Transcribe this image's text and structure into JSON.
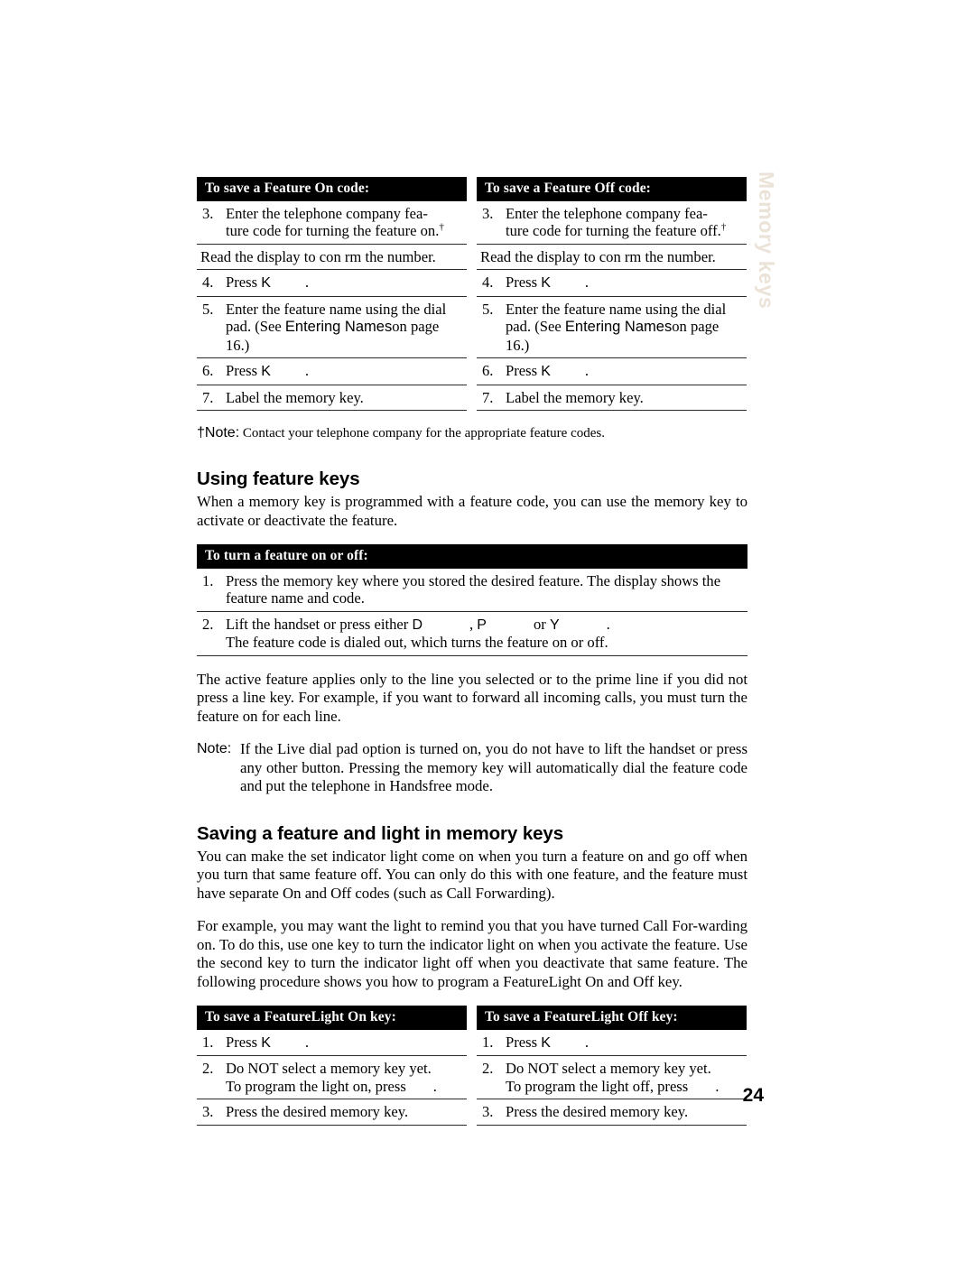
{
  "page": {
    "number": "24",
    "side_tab": "Memory keys"
  },
  "feature_code_tables": {
    "on": {
      "header": "To save a Feature On code:",
      "rows": [
        {
          "num": "3.",
          "text": "Enter the telephone company fea-ture code for turning the feature on.",
          "sup": "†"
        },
        {
          "num": "",
          "text": "Read the display to con  rm the number."
        },
        {
          "num": "4.",
          "text": "Press K",
          "trailing": "."
        },
        {
          "num": "5.",
          "text": "pad. (See ",
          "pre": "Enter the feature name using the dial ",
          "xref": "Entering Names",
          "post": "on page 16.)"
        },
        {
          "num": "6.",
          "text": "Press K",
          "trailing": "."
        },
        {
          "num": "7.",
          "text": "Label the memory key."
        }
      ]
    },
    "off": {
      "header": "To save a Feature Off code:",
      "rows": [
        {
          "num": "3.",
          "text": "Enter the telephone company fea-ture code for turning the feature off.",
          "sup": "†"
        },
        {
          "num": "",
          "text": "Read the display to con  rm the number."
        },
        {
          "num": "4.",
          "text": "Press K",
          "trailing": "."
        },
        {
          "num": "5.",
          "text": "pad. (See ",
          "pre": "Enter the feature name using the dial ",
          "xref": "Entering Names",
          "post": "on page 16.)"
        },
        {
          "num": "6.",
          "text": "Press K",
          "trailing": "."
        },
        {
          "num": "7.",
          "text": "Label the memory key."
        }
      ]
    },
    "footnote_label": "†Note:",
    "footnote_text": "Contact your telephone company for the appropriate feature codes."
  },
  "using_feature_keys": {
    "heading": "Using feature keys",
    "intro": "When a memory key is programmed with a feature code, you can use the memory key to activate or deactivate the feature.",
    "table": {
      "header": "To turn a feature on or off:",
      "rows": [
        {
          "num": "1.",
          "text": "Press the memory key where you stored the desired feature. The display shows the feature name and code."
        },
        {
          "num": "2.",
          "line1_a": "Lift the handset or press either ",
          "key1": "D",
          "sep1": ", ",
          "key2": "P",
          "sep2": "or ",
          "key3": "Y",
          "end": ".",
          "line2": "The feature code is dialed out, which turns the feature on or off."
        }
      ]
    },
    "para_after": "The active feature applies only to the line you selected or to the prime line if you did not press a line key. For example, if you want to forward all incoming calls, you must turn the feature on for each line.",
    "note_label": "Note:",
    "note_text": "If the Live dial pad option is turned on, you do not have to lift the handset or press any other button. Pressing the memory key will automatically dial the feature code and put the telephone in Handsfree mode."
  },
  "saving_feature_light": {
    "heading": "Saving a feature and light in memory keys",
    "para1": "You can make the set indicator light come on when you turn a feature on and go off when you turn that same feature off. You can only do this with one feature, and the feature must have separate On and Off codes (such as Call Forwarding).",
    "para2": "For example, you may want the light to remind you that you have turned Call For-warding on. To do this, use one key to turn the indicator light on when you activate the feature. Use the second key to turn the indicator light off when you deactivate that same feature. The following procedure shows you how to program a FeatureLight On and Off key.",
    "tables": {
      "on": {
        "header": "To save a FeatureLight On key:",
        "rows": [
          {
            "num": "1.",
            "text": "Press K",
            "trailing": "."
          },
          {
            "num": "2.",
            "line1": "Do NOT select a memory key yet.",
            "line2": "To program the light on, press",
            "trailing": "."
          },
          {
            "num": "3.",
            "text": "Press the desired memory key."
          }
        ]
      },
      "off": {
        "header": "To save a FeatureLight Off key:",
        "rows": [
          {
            "num": "1.",
            "text": "Press K",
            "trailing": "."
          },
          {
            "num": "2.",
            "line1": "Do NOT select a memory key yet.",
            "line2": "To program the light off, press",
            "trailing": "."
          },
          {
            "num": "3.",
            "text": "Press the desired memory key."
          }
        ]
      }
    }
  }
}
